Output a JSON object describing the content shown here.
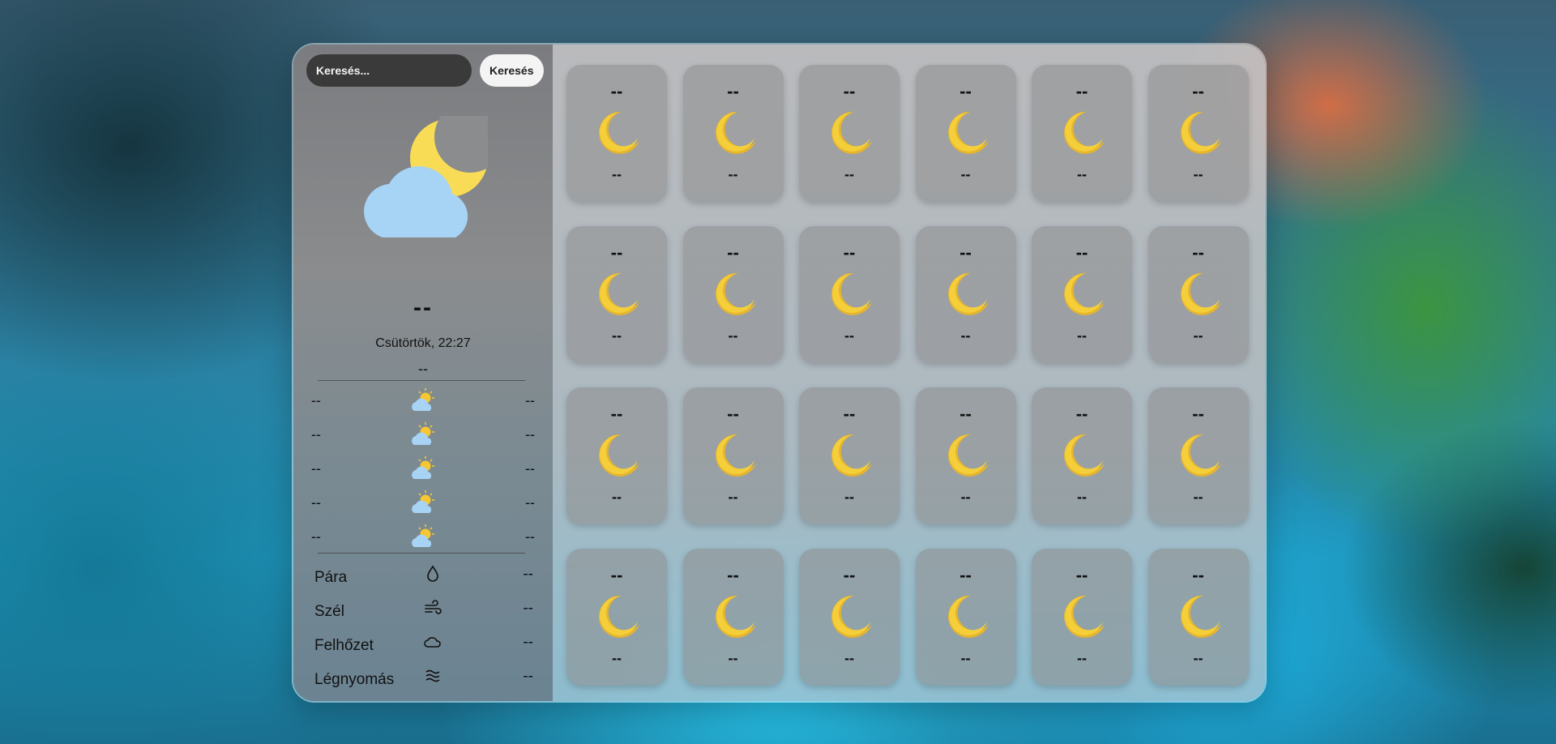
{
  "search": {
    "placeholder": "Keresés...",
    "button_label": "Keresés"
  },
  "current": {
    "icon": "moon-cloud-icon",
    "temperature": "--",
    "datetime": "Csütörtök, 22:27",
    "description": "--"
  },
  "daily_forecast": [
    {
      "day": "--",
      "icon": "sun-cloud-icon",
      "value": "--"
    },
    {
      "day": "--",
      "icon": "sun-cloud-icon",
      "value": "--"
    },
    {
      "day": "--",
      "icon": "sun-cloud-icon",
      "value": "--"
    },
    {
      "day": "--",
      "icon": "sun-cloud-icon",
      "value": "--"
    },
    {
      "day": "--",
      "icon": "sun-cloud-icon",
      "value": "--"
    }
  ],
  "details": [
    {
      "label": "Pára",
      "icon": "droplet-icon",
      "value": "--"
    },
    {
      "label": "Szél",
      "icon": "wind-icon",
      "value": "--"
    },
    {
      "label": "Felhőzet",
      "icon": "cloud-icon",
      "value": "--"
    },
    {
      "label": "Légnyomás",
      "icon": "pressure-icon",
      "value": "--"
    }
  ],
  "hourly": [
    {
      "top": "--",
      "icon": "moon-icon",
      "bottom": "--"
    },
    {
      "top": "--",
      "icon": "moon-icon",
      "bottom": "--"
    },
    {
      "top": "--",
      "icon": "moon-icon",
      "bottom": "--"
    },
    {
      "top": "--",
      "icon": "moon-icon",
      "bottom": "--"
    },
    {
      "top": "--",
      "icon": "moon-icon",
      "bottom": "--"
    },
    {
      "top": "--",
      "icon": "moon-icon",
      "bottom": "--"
    },
    {
      "top": "--",
      "icon": "moon-icon",
      "bottom": "--"
    },
    {
      "top": "--",
      "icon": "moon-icon",
      "bottom": "--"
    },
    {
      "top": "--",
      "icon": "moon-icon",
      "bottom": "--"
    },
    {
      "top": "--",
      "icon": "moon-icon",
      "bottom": "--"
    },
    {
      "top": "--",
      "icon": "moon-icon",
      "bottom": "--"
    },
    {
      "top": "--",
      "icon": "moon-icon",
      "bottom": "--"
    },
    {
      "top": "--",
      "icon": "moon-icon",
      "bottom": "--"
    },
    {
      "top": "--",
      "icon": "moon-icon",
      "bottom": "--"
    },
    {
      "top": "--",
      "icon": "moon-icon",
      "bottom": "--"
    },
    {
      "top": "--",
      "icon": "moon-icon",
      "bottom": "--"
    },
    {
      "top": "--",
      "icon": "moon-icon",
      "bottom": "--"
    },
    {
      "top": "--",
      "icon": "moon-icon",
      "bottom": "--"
    },
    {
      "top": "--",
      "icon": "moon-icon",
      "bottom": "--"
    },
    {
      "top": "--",
      "icon": "moon-icon",
      "bottom": "--"
    },
    {
      "top": "--",
      "icon": "moon-icon",
      "bottom": "--"
    },
    {
      "top": "--",
      "icon": "moon-icon",
      "bottom": "--"
    },
    {
      "top": "--",
      "icon": "moon-icon",
      "bottom": "--"
    },
    {
      "top": "--",
      "icon": "moon-icon",
      "bottom": "--"
    }
  ],
  "colors": {
    "moon": "#f5cf3a",
    "moon_shade": "#e6b52e",
    "cloud": "#a7d3f5",
    "sun": "#f7c631"
  }
}
